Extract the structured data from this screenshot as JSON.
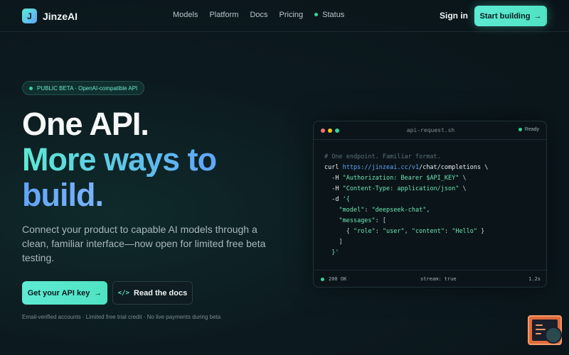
{
  "nav": {
    "logo_letter": "J",
    "brand": "JinzeAI",
    "links": [
      "Models",
      "Platform",
      "Docs",
      "Pricing"
    ],
    "status": "Status",
    "signin": "Sign in",
    "start": "Start building",
    "start_arrow": "→"
  },
  "hero": {
    "badge": "PUBLIC BETA · OpenAI-compatible API",
    "line1": "One API.",
    "line2": "More ways to",
    "line3": "build.",
    "subtitle": "Connect your product to capable AI models through a clean, familiar interface—now open for limited free beta testing.",
    "cta_primary": "Get your API key",
    "cta_primary_arrow": "→",
    "cta_secondary_icon": "</>",
    "cta_secondary": "Read the docs",
    "fine_print": "Email-verified accounts · Limited free trial credit · No live payments during beta"
  },
  "card": {
    "filename": "api-request.sh",
    "ready": "Ready",
    "lines": {
      "comment": "# One endpoint. Familiar format.",
      "curl": "curl",
      "url_host": "https://jinzeai.cc/v1",
      "url_path": "/chat/completions \\",
      "h1_flag": "-H",
      "h1_val": "\"Authorization: Bearer $API_KEY\"",
      "h1_tail": "\\",
      "h2_flag": "-H",
      "h2_val": "\"Content-Type: application/json\"",
      "h2_tail": "\\",
      "d_flag": "-d",
      "d_open": "'{",
      "model_key": "\"model\"",
      "model_val": "\"deepseek-chat\",",
      "messages_key": "\"messages\"",
      "messages_open": ": [",
      "msg_open": "{ ",
      "role_key": "\"role\"",
      "role_val": "\"user\",",
      "content_key": "\"content\"",
      "content_val": "\"Hello\"",
      "msg_close": " }",
      "arr_close": "]",
      "obj_close": "}'"
    },
    "footer": {
      "status": "200 OK",
      "stream": "stream: true",
      "time": "1.2s"
    }
  },
  "colors": {
    "accent": "#5eead4",
    "accent_blue": "#60a5fa",
    "status_green": "#34d399"
  },
  "icons": {
    "logo": "logo-mark-icon",
    "arrow": "arrow-right-icon",
    "code": "code-brackets-icon",
    "widget": "feedback-widget-icon"
  }
}
